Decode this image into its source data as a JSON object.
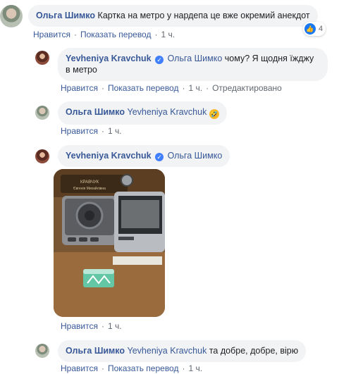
{
  "comments": [
    {
      "author": "Ольга Шимко",
      "text": "Картка на метро у нардепа це вже окремий анекдот",
      "actions": {
        "like": "Нравится",
        "translate": "Показать перевод",
        "time": "1 ч."
      },
      "reactions": {
        "icon": "like",
        "count": "4"
      }
    },
    {
      "author": "Yevheniya Kravchuk",
      "mention": "Ольга Шимко",
      "text_line1": "чому? Я щодня їжджу",
      "text_line2": "в метро",
      "actions": {
        "like": "Нравится",
        "translate": "Показать перевод",
        "time": "1 ч.",
        "edited": "Отредактировано"
      }
    },
    {
      "author": "Ольга Шимко",
      "mention": "Yevheniya Kravchuk",
      "emoji": "rolling-on-floor-laughing",
      "actions": {
        "like": "Нравится",
        "time": "1 ч."
      }
    },
    {
      "author": "Yevheniya Kravchuk",
      "mention": "Ольга Шимко",
      "photo": {
        "nameplate_line1": "КРАВЧУК",
        "nameplate_line2": "Євгенія Михайлівна"
      },
      "actions": {
        "like": "Нравится",
        "time": "1 ч."
      }
    },
    {
      "author": "Ольга Шимко",
      "mention": "Yevheniya Kravchuk",
      "text": "та добре, добре, вірю",
      "actions": {
        "like": "Нравится",
        "translate": "Показать перевод",
        "time": "1 ч."
      }
    }
  ],
  "colors": {
    "link": "#385898",
    "bubble": "#f2f3f5",
    "meta": "#606770",
    "like": "#1877f2",
    "verified": "#4080ff"
  }
}
